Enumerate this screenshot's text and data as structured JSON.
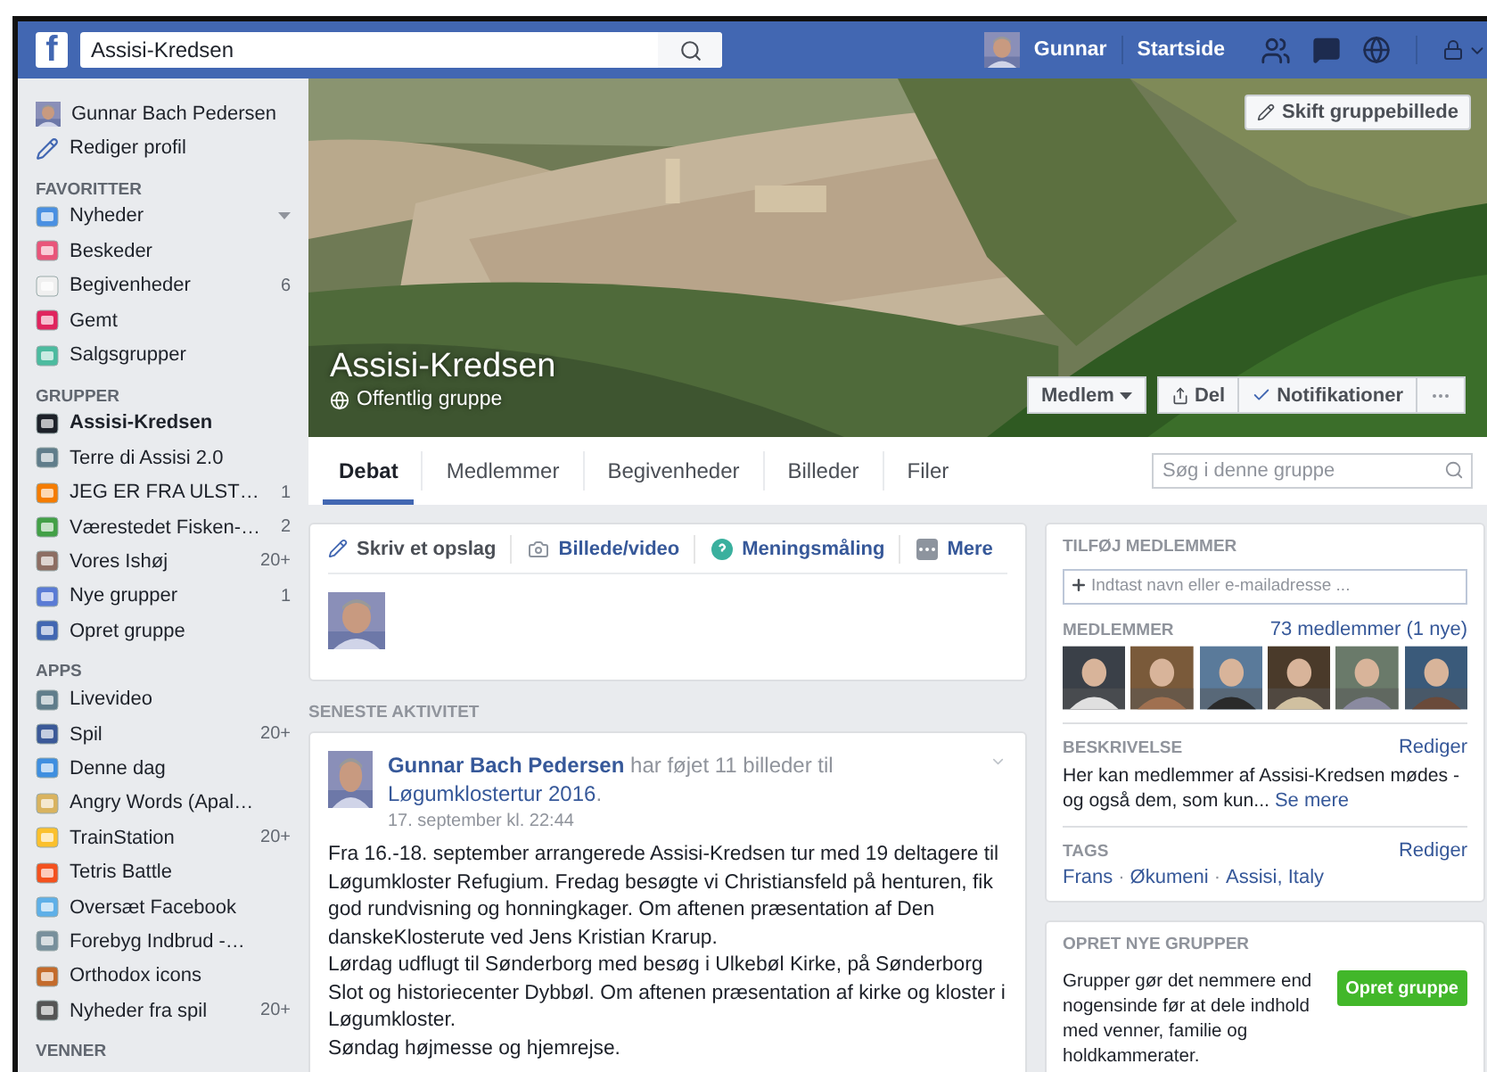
{
  "top_bar": {
    "logo": "f",
    "search_value": "Assisi-Kredsen",
    "user": "Gunnar",
    "home": "Startside"
  },
  "sidebar": {
    "profile_name": "Gunnar Bach Pedersen",
    "edit_profile": "Rediger profil",
    "sections": [
      {
        "title": "FAVORITTER",
        "items": [
          {
            "label": "Nyheder",
            "has_menu": true,
            "selected": false
          },
          {
            "label": "Beskeder",
            "has_menu": false,
            "selected": false
          },
          {
            "label": "Begivenheder",
            "count": "6",
            "has_menu": false,
            "selected": false
          },
          {
            "label": "Gemt",
            "has_menu": false,
            "selected": false
          },
          {
            "label": "Salgsgrupper",
            "has_menu": false,
            "selected": false
          }
        ]
      },
      {
        "title": "GRUPPER",
        "items": [
          {
            "label": "Assisi-Kredsen",
            "has_menu": false,
            "selected": true
          },
          {
            "label": "Terre di Assisi 2.0",
            "has_menu": false,
            "selected": false
          },
          {
            "label": "JEG ER FRA ULST…",
            "count": "1",
            "has_menu": false,
            "selected": false
          },
          {
            "label": "Værestedet Fisken-…",
            "count": "2",
            "has_menu": false,
            "selected": false
          },
          {
            "label": "Vores Ishøj",
            "count": "20+",
            "has_menu": false,
            "selected": false
          },
          {
            "label": "Nye grupper",
            "count": "1",
            "has_menu": false,
            "selected": false
          },
          {
            "label": "Opret gruppe",
            "has_menu": false,
            "selected": false
          }
        ]
      },
      {
        "title": "APPS",
        "items": [
          {
            "label": "Livevideo",
            "has_menu": false,
            "selected": false
          },
          {
            "label": "Spil",
            "count": "20+",
            "has_menu": false,
            "selected": false
          },
          {
            "label": "Denne dag",
            "has_menu": false,
            "selected": false
          },
          {
            "label": "Angry Words (Apal…",
            "has_menu": false,
            "selected": false
          },
          {
            "label": "TrainStation",
            "count": "20+",
            "has_menu": false,
            "selected": false
          },
          {
            "label": "Tetris Battle",
            "has_menu": false,
            "selected": false
          },
          {
            "label": "Oversæt Facebook",
            "has_menu": false,
            "selected": false
          },
          {
            "label": "Forebyg Indbrud -…",
            "has_menu": false,
            "selected": false
          },
          {
            "label": "Orthodox icons",
            "has_menu": false,
            "selected": false
          },
          {
            "label": "Nyheder fra spil",
            "count": "20+",
            "has_menu": false,
            "selected": false
          }
        ]
      },
      {
        "title": "VENNER"
      }
    ]
  },
  "cover": {
    "kind": "picture",
    "change_button": "Skift gruppebillede",
    "group_name": "Assisi-Kredsen",
    "privacy": "Offentlig gruppe",
    "actions": [
      {
        "label": "Medlem",
        "kind": "dropdown"
      },
      {
        "label": "Del",
        "kind": "share"
      },
      {
        "label": "Notifikationer",
        "kind": "check"
      },
      {
        "kind": "more"
      }
    ]
  },
  "tabs": [
    {
      "label": "Debat",
      "selected": true
    },
    {
      "label": "Medlemmer",
      "selected": false
    },
    {
      "label": "Begivenheder",
      "selected": false
    },
    {
      "label": "Billeder",
      "selected": false
    },
    {
      "label": "Filer",
      "selected": false
    }
  ],
  "group_search": {
    "placeholder": "Søg i denne gruppe"
  },
  "composer": {
    "actions": [
      {
        "label": "Skriv et opslag",
        "selected": true
      },
      {
        "label": "Billede/video",
        "selected": false
      },
      {
        "label": "Meningsmåling",
        "selected": false
      },
      {
        "label": "Mere",
        "selected": false
      }
    ]
  },
  "activity_heading": "SENESTE AKTIVITET",
  "post": {
    "author": "Gunnar Bach Pedersen",
    "action": "har føjet 11 billeder til",
    "album": "Løgumklostertur 2016",
    "end": ".",
    "time": "17. september kl. 22:44",
    "paragraphs": [
      "Fra 16.-18. september arrangerede Assisi-Kredsen tur med 19 deltagere til Løgumkloster Refugium. Fredag besøgte vi Christiansfeld på henturen, fik god rundvisning og honningkager. Om aftenen præsentation af Den danskeKlosterute ved Jens Kristian Krarup.",
      "Lørdag udflugt til Sønderborg med besøg i Ulkebøl Kirke, på Sønderborg Slot og historiecenter Dybbøl. Om aftenen præsentation af kirke og kloster i Løgumkloster.",
      "Søndag højmesse og hjemrejse."
    ]
  },
  "right": {
    "add_heading": "TILFØJ MEDLEMMER",
    "add_placeholder": "Indtast navn eller e-mailadresse ...",
    "members_heading": "MEDLEMMER",
    "members_link": "73 medlemmer (1 nye)",
    "member_photos": [
      {
        "kind": "picture"
      },
      {
        "kind": "picture"
      },
      {
        "kind": "picture"
      },
      {
        "kind": "picture"
      },
      {
        "kind": "picture"
      },
      {
        "kind": "picture"
      }
    ],
    "description_heading": "BESKRIVELSE",
    "edit": "Rediger",
    "description": "Her kan medlemmer af Assisi-Kredsen mødes - og også dem, som kun...",
    "see_more": "Se mere",
    "tags_heading": "TAGS",
    "tags_edit": "Rediger",
    "tags": [
      "Frans",
      "Økumeni",
      "Assisi, Italy"
    ],
    "tag_separator": "·",
    "create_heading": "OPRET NYE GRUPPER",
    "create_text": "Grupper gør det nemmere end nogensinde før at dele indhold med venner, familie og holdkammerater.",
    "create_button": "Opret gruppe"
  }
}
